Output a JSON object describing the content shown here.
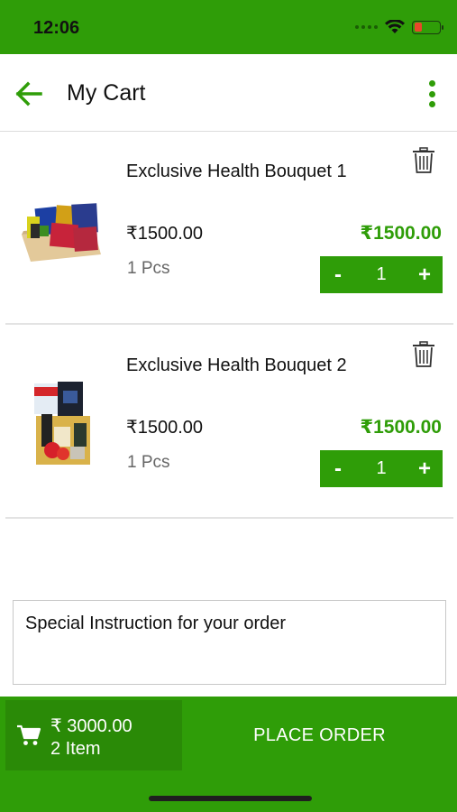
{
  "status_bar": {
    "time": "12:06"
  },
  "header": {
    "title": "My Cart"
  },
  "cart": {
    "items": [
      {
        "name": "Exclusive Health Bouquet 1",
        "price": "₹1500.00",
        "qty_label": "1 Pcs",
        "total": "₹1500.00",
        "quantity": "1",
        "minus": "-",
        "plus": "+"
      },
      {
        "name": "Exclusive Health Bouquet 2",
        "price": "₹1500.00",
        "qty_label": "1 Pcs",
        "total": "₹1500.00",
        "quantity": "1",
        "minus": "-",
        "plus": "+"
      }
    ]
  },
  "instruction": {
    "placeholder": "Special Instruction for your order"
  },
  "footer": {
    "total": "₹ 3000.00",
    "item_count": "2 Item",
    "place_order_label": "PLACE ORDER"
  },
  "colors": {
    "accent": "#2f9d08",
    "summary_bg": "#2a8a07"
  },
  "icons": [
    "back-arrow-icon",
    "more-vertical-icon",
    "trash-icon",
    "cart-icon",
    "wifi-icon",
    "battery-icon"
  ]
}
